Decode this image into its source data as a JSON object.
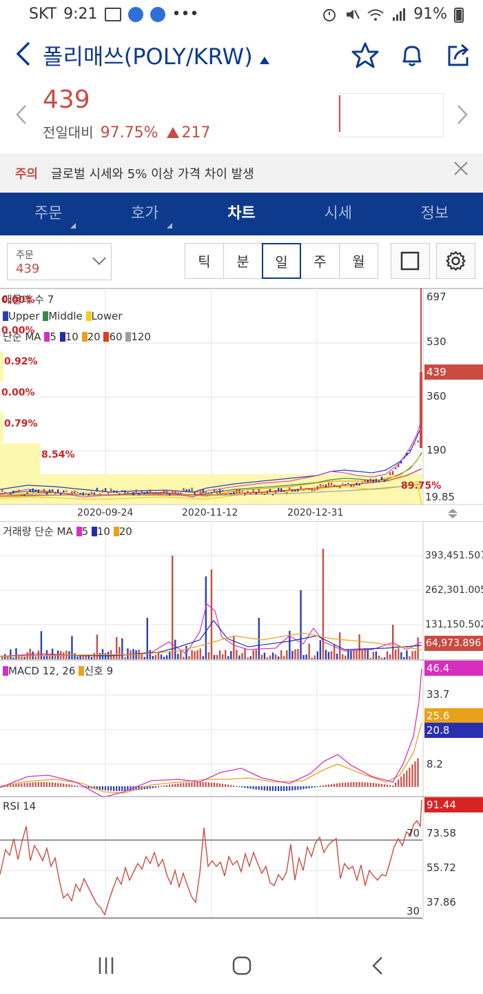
{
  "status_bar": {
    "carrier": "SKT",
    "time": "9:21",
    "battery": "91%"
  },
  "header": {
    "title": "폴리매쓰(POLY/KRW)"
  },
  "price": {
    "current": "439",
    "change_label": "전일대비",
    "change_pct": "97.75%",
    "change_amount": "217"
  },
  "notice": {
    "tag": "주의",
    "message": "글로벌 시세와 5% 이상 가격 차이 발생"
  },
  "tabs": [
    {
      "label": "주문",
      "active": false
    },
    {
      "label": "호가",
      "active": false
    },
    {
      "label": "차트",
      "active": true
    },
    {
      "label": "시세",
      "active": false
    },
    {
      "label": "정보",
      "active": false
    }
  ],
  "order_select": {
    "label": "주문",
    "value": "439"
  },
  "periods": [
    {
      "label": "틱",
      "active": false
    },
    {
      "label": "분",
      "active": false
    },
    {
      "label": "일",
      "active": true
    },
    {
      "label": "주",
      "active": false
    },
    {
      "label": "월",
      "active": false
    }
  ],
  "colors": {
    "brand": "#0d3a8c",
    "up": "#c94b42",
    "down": "#2a3fae",
    "ma5": "#d62fbf",
    "ma10": "#1f2faa",
    "ma20": "#e8a21a",
    "ma60": "#e23b1c",
    "ma120": "#9e9e9e",
    "lower": "#f0cf1f",
    "middle": "#3a8a4a"
  },
  "price_chart": {
    "legend_title": "매물대 수 7",
    "band_legend": [
      "Upper",
      "Middle",
      "Lower"
    ],
    "ma_label": "단순 MA",
    "ma_periods": [
      "5",
      "10",
      "20",
      "60",
      "120"
    ],
    "volume_profile_labels": [
      "0.00%",
      "0.00%",
      "0.92%",
      "0.00%",
      "0.79%",
      "8.54%",
      "89.75%"
    ],
    "y_ticks": [
      "697",
      "530",
      "360",
      "190",
      "19.85"
    ],
    "current_price_label": "439",
    "x_dates": [
      "2020-09-24",
      "2020-11-12",
      "2020-12-31"
    ]
  },
  "volume_chart": {
    "title": "거래량 단순 MA",
    "ma_periods": [
      "5",
      "10",
      "20"
    ],
    "y_ticks": [
      "393,451.507",
      "262,301.005",
      "131,150.502"
    ],
    "current_label": "64,973.896"
  },
  "macd_chart": {
    "title": "MACD 12, 26",
    "signal_label": "신호 9",
    "y_ticks": [
      "33.7",
      "8.2"
    ],
    "badges": [
      "46.4",
      "25.6",
      "20.8"
    ]
  },
  "rsi_chart": {
    "title": "RSI 14",
    "y_ticks": [
      "73.58",
      "55.72",
      "37.86"
    ],
    "current_label": "91.44",
    "level_high": "70",
    "level_low": "30"
  }
}
